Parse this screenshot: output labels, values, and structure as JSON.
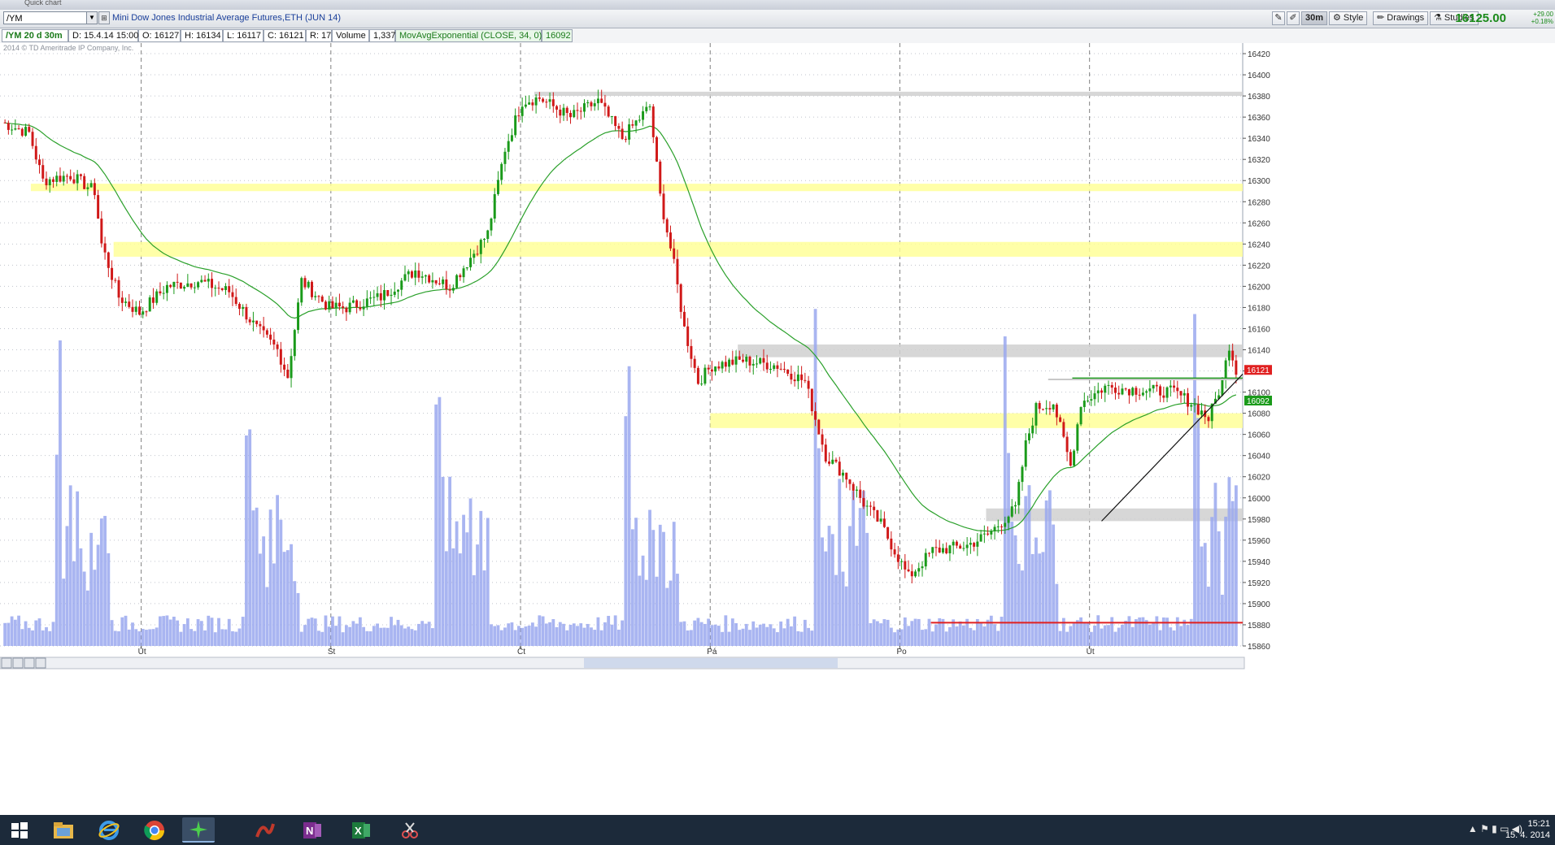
{
  "toolbar": {
    "window_title": "Quick chart",
    "symbol": "/YM",
    "description": "Mini Dow Jones Industrial Average Futures,ETH (JUN 14)",
    "period": "30m",
    "style_label": "Style",
    "drawings_label": "Drawings",
    "studies_label": "Studies",
    "last_price": "16125.00",
    "change_abs": "+29.00",
    "change_pct": "+0.18%"
  },
  "info": {
    "spec": "/YM 20 d 30m",
    "date": "D: 15.4.14 15:00",
    "open": "O: 16127",
    "high": "H: 16134",
    "low": "L: 16117",
    "close": "C: 16121",
    "range": "R: 17",
    "volume_label": "Volume",
    "volume": "1,337",
    "study": "MovAvgExponential (CLOSE, 34, 0)",
    "study_value": "16092"
  },
  "copyright": "2014 © TD Ameritrade IP Company, Inc.",
  "chart_data": {
    "type": "candlestick",
    "ylim": [
      15860,
      16430
    ],
    "yticks": [
      15860,
      15880,
      15900,
      15920,
      15940,
      15960,
      15980,
      16000,
      16020,
      16040,
      16060,
      16080,
      16100,
      16120,
      16140,
      16160,
      16180,
      16200,
      16220,
      16240,
      16260,
      16280,
      16300,
      16320,
      16340,
      16360,
      16380,
      16400,
      16420
    ],
    "day_labels": [
      {
        "label": "Út",
        "bar": 40
      },
      {
        "label": "St",
        "bar": 95
      },
      {
        "label": "Čt",
        "bar": 150
      },
      {
        "label": "Pá",
        "bar": 205
      },
      {
        "label": "Po",
        "bar": 260
      },
      {
        "label": "Út",
        "bar": 315
      }
    ],
    "n_bars": 358,
    "close_anchors": [
      [
        0,
        16355
      ],
      [
        8,
        16345
      ],
      [
        12,
        16300
      ],
      [
        20,
        16305
      ],
      [
        27,
        16290
      ],
      [
        29,
        16240
      ],
      [
        34,
        16190
      ],
      [
        40,
        16175
      ],
      [
        48,
        16200
      ],
      [
        57,
        16205
      ],
      [
        66,
        16195
      ],
      [
        74,
        16160
      ],
      [
        80,
        16140
      ],
      [
        83,
        16115
      ],
      [
        87,
        16205
      ],
      [
        95,
        16180
      ],
      [
        100,
        16180
      ],
      [
        110,
        16190
      ],
      [
        120,
        16215
      ],
      [
        130,
        16200
      ],
      [
        141,
        16250
      ],
      [
        146,
        16330
      ],
      [
        151,
        16375
      ],
      [
        156,
        16378
      ],
      [
        165,
        16360
      ],
      [
        173,
        16375
      ],
      [
        180,
        16340
      ],
      [
        188,
        16370
      ],
      [
        191,
        16285
      ],
      [
        195,
        16220
      ],
      [
        198,
        16160
      ],
      [
        202,
        16110
      ],
      [
        206,
        16125
      ],
      [
        215,
        16130
      ],
      [
        225,
        16125
      ],
      [
        233,
        16110
      ],
      [
        239,
        16040
      ],
      [
        245,
        16020
      ],
      [
        250,
        15995
      ],
      [
        255,
        15975
      ],
      [
        259,
        15950
      ],
      [
        263,
        15925
      ],
      [
        270,
        15950
      ],
      [
        280,
        15955
      ],
      [
        286,
        15965
      ],
      [
        294,
        15990
      ],
      [
        297,
        16050
      ],
      [
        300,
        16085
      ],
      [
        305,
        16090
      ],
      [
        310,
        16030
      ],
      [
        313,
        16090
      ],
      [
        320,
        16105
      ],
      [
        330,
        16102
      ],
      [
        340,
        16100
      ],
      [
        345,
        16090
      ],
      [
        350,
        16075
      ],
      [
        354,
        16110
      ],
      [
        356,
        16145
      ],
      [
        358,
        16121
      ]
    ],
    "series": [
      {
        "name": "MovAvgExponential (CLOSE, 34, 0)",
        "color": "#2aa02a"
      },
      {
        "name": "Volume",
        "color": "#9aa8ee"
      }
    ],
    "zones": [
      {
        "color": "#ffff99",
        "from": 16290,
        "to": 16297,
        "start_bar": 8
      },
      {
        "color": "#ffff99",
        "from": 16228,
        "to": 16242,
        "start_bar": 32
      },
      {
        "color": "#ffff99",
        "from": 16066,
        "to": 16080,
        "start_bar": 205
      },
      {
        "color": "#d0d0d0",
        "from": 16380,
        "to": 16384,
        "start_bar": 154
      },
      {
        "color": "#d0d0d0",
        "from": 16133,
        "to": 16145,
        "start_bar": 213
      },
      {
        "color": "#d0d0d0",
        "from": 15978,
        "to": 15990,
        "start_bar": 285
      }
    ],
    "lines": [
      {
        "color": "#e02020",
        "y": 15882,
        "start_bar": 269
      },
      {
        "color": "#1a9a1a",
        "y": 16113,
        "start_bar": 310
      },
      {
        "color": "#c8c8c8",
        "y": 16112,
        "start_bar": 303
      }
    ],
    "trendline": {
      "color": "#111111",
      "from_bar": 318,
      "from_y": 15978,
      "to_bar": 358,
      "to_y": 16117
    },
    "price_tags": [
      {
        "value": "16121",
        "color": "#e02020"
      },
      {
        "value": "16092",
        "color": "#1a9a1a"
      }
    ]
  },
  "taskbar": {
    "icons": [
      "windows-logo",
      "explorer",
      "internet-explorer",
      "chrome",
      "thinkorswim",
      "app-red",
      "onenote",
      "excel",
      "snipping-tool"
    ],
    "time": "15:21",
    "date": "15. 4. 2014"
  }
}
